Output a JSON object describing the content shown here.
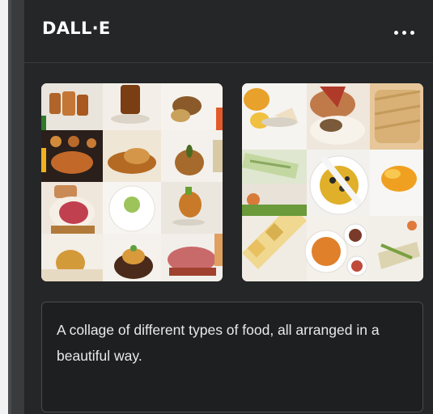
{
  "panel": {
    "title": "DALL·E",
    "menu_icon": "more-horizontal-icon"
  },
  "results": [
    {
      "name": "food-collage-image-1"
    },
    {
      "name": "food-collage-image-2"
    }
  ],
  "prompt": {
    "text": "A collage of different types of food, all arranged in a beautiful way."
  },
  "colors": {
    "panel_bg": "#252627",
    "prompt_bg": "#1e1f20",
    "border": "#4a4b4d",
    "text": "#ffffff"
  }
}
